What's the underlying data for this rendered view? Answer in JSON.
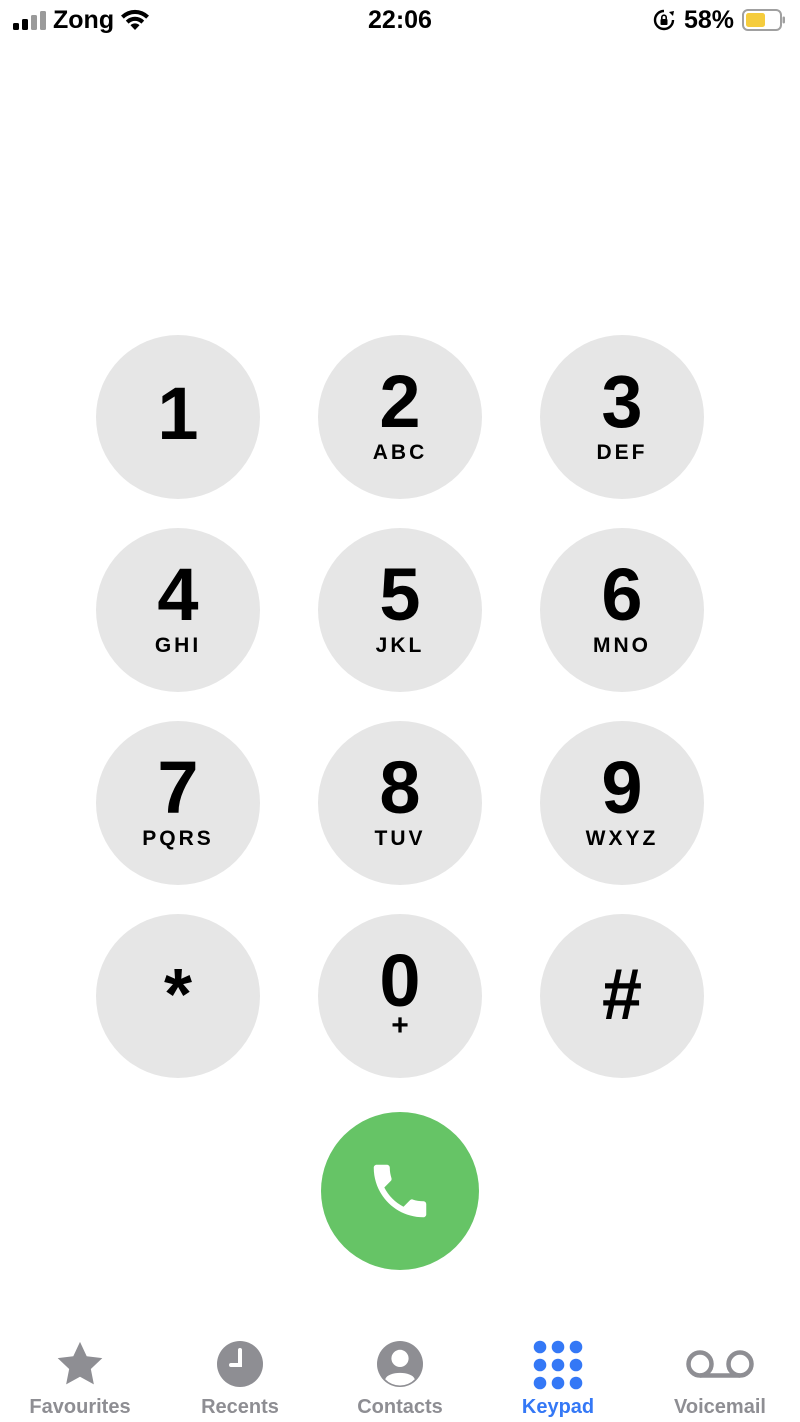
{
  "status_bar": {
    "carrier": "Zong",
    "time": "22:06",
    "battery_percent": "58%",
    "battery_level": 0.58,
    "signal_bars_active": 2,
    "signal_bars_total": 4
  },
  "keypad": {
    "keys": [
      {
        "digit": "1",
        "letters": ""
      },
      {
        "digit": "2",
        "letters": "ABC"
      },
      {
        "digit": "3",
        "letters": "DEF"
      },
      {
        "digit": "4",
        "letters": "GHI"
      },
      {
        "digit": "5",
        "letters": "JKL"
      },
      {
        "digit": "6",
        "letters": "MNO"
      },
      {
        "digit": "7",
        "letters": "PQRS"
      },
      {
        "digit": "8",
        "letters": "TUV"
      },
      {
        "digit": "9",
        "letters": "WXYZ"
      },
      {
        "digit": "*",
        "letters": ""
      },
      {
        "digit": "0",
        "letters": "+"
      },
      {
        "digit": "#",
        "letters": ""
      }
    ]
  },
  "call_button": {
    "icon": "phone-icon"
  },
  "tab_bar": {
    "tabs": [
      {
        "label": "Favourites",
        "icon": "star-icon",
        "active": false
      },
      {
        "label": "Recents",
        "icon": "clock-icon",
        "active": false
      },
      {
        "label": "Contacts",
        "icon": "person-icon",
        "active": false
      },
      {
        "label": "Keypad",
        "icon": "keypad-icon",
        "active": true
      },
      {
        "label": "Voicemail",
        "icon": "voicemail-icon",
        "active": false
      }
    ]
  },
  "colors": {
    "key_background": "#e6e6e6",
    "call_green": "#66c466",
    "active_blue": "#3478f6",
    "inactive_gray": "#8e8e93",
    "battery_yellow": "#f5cc3d"
  }
}
